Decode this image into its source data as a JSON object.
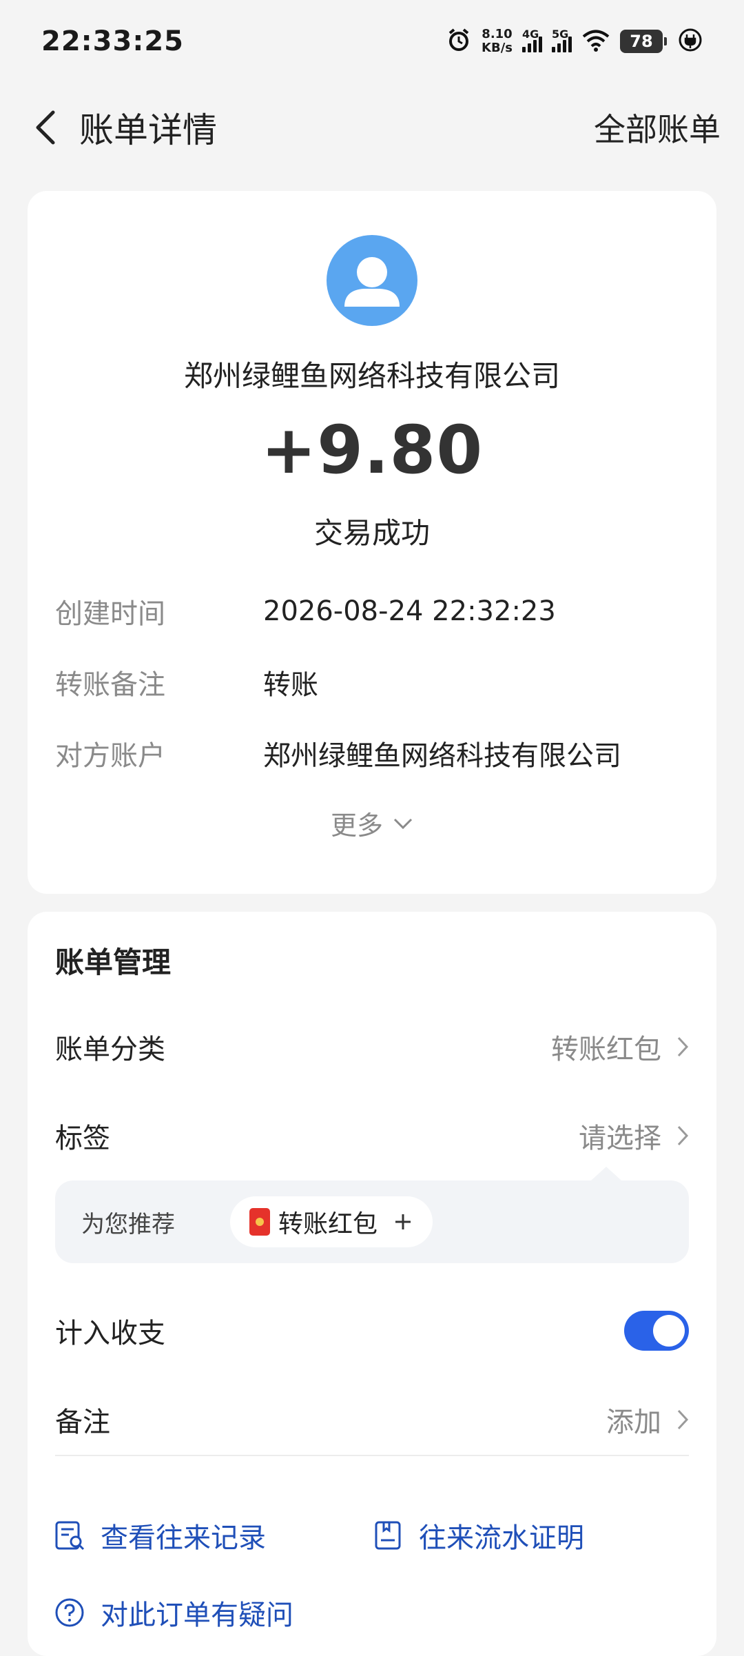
{
  "status_bar": {
    "time": "22:33:25",
    "speed_value": "8.10",
    "speed_unit": "KB/s",
    "net1": "4G",
    "net2": "5G",
    "battery": "78",
    "icons": [
      "alarm-icon",
      "signal-4g-icon",
      "signal-5g-icon",
      "wifi-icon",
      "battery-icon",
      "charging-icon"
    ]
  },
  "header": {
    "title": "账单详情",
    "right_link": "全部账单"
  },
  "summary": {
    "merchant": "郑州绿鲤鱼网络科技有限公司",
    "amount": "+9.80",
    "status": "交易成功",
    "details": [
      {
        "label": "创建时间",
        "value": "2026-08-24 22:32:23"
      },
      {
        "label": "转账备注",
        "value": "转账"
      },
      {
        "label": "对方账户",
        "value": "郑州绿鲤鱼网络科技有限公司"
      }
    ],
    "more_label": "更多"
  },
  "management": {
    "title": "账单管理",
    "category_label": "账单分类",
    "category_value": "转账红包",
    "tag_label": "标签",
    "tag_value": "请选择",
    "recommend_label": "为您推荐",
    "recommend_chip": "转账红包",
    "count_label": "计入收支",
    "count_enabled": true,
    "remark_label": "备注",
    "remark_value": "添加",
    "links": {
      "history": "查看往来记录",
      "proof": "往来流水证明",
      "question": "对此订单有疑问"
    }
  },
  "colors": {
    "background": "#f4f4f4",
    "card": "#ffffff",
    "accent_blue": "#2a62e8",
    "link_blue": "#1f4fb8",
    "avatar_blue": "#5aa6f0",
    "muted": "#8a8a8a"
  }
}
